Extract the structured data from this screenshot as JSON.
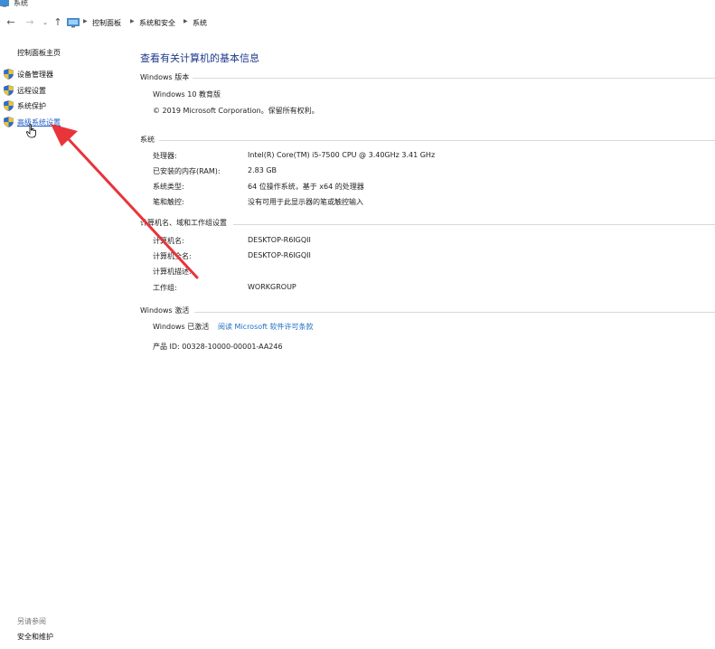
{
  "window": {
    "title": "系统"
  },
  "breadcrumb": {
    "items": [
      "控制面板",
      "系统和安全",
      "系统"
    ]
  },
  "sidebar": {
    "home_label": "控制面板主页",
    "items": [
      {
        "label": "设备管理器"
      },
      {
        "label": "远程设置"
      },
      {
        "label": "系统保护"
      },
      {
        "label": "高级系统设置"
      }
    ],
    "see_also_label": "另请参阅",
    "see_also_items": [
      {
        "label": "安全和维护"
      }
    ]
  },
  "main": {
    "title": "查看有关计算机的基本信息",
    "edition": {
      "header": "Windows 版本",
      "name": "Windows 10 教育版",
      "copyright": "© 2019 Microsoft Corporation。保留所有权利。"
    },
    "system": {
      "header": "系统",
      "rows": [
        {
          "label": "处理器:",
          "value": "Intel(R) Core(TM) i5-7500 CPU @ 3.40GHz   3.41 GHz"
        },
        {
          "label": "已安装的内存(RAM):",
          "value": "2.83 GB"
        },
        {
          "label": "系统类型:",
          "value": "64 位操作系统，基于 x64 的处理器"
        },
        {
          "label": "笔和触控:",
          "value": "没有可用于此显示器的笔或触控输入"
        }
      ]
    },
    "computer_name": {
      "header": "计算机名、域和工作组设置",
      "rows": [
        {
          "label": "计算机名:",
          "value": "DESKTOP-R6IGQII"
        },
        {
          "label": "计算机全名:",
          "value": "DESKTOP-R6IGQII"
        },
        {
          "label": "计算机描述:",
          "value": ""
        },
        {
          "label": "工作组:",
          "value": "WORKGROUP"
        }
      ]
    },
    "activation": {
      "header": "Windows 激活",
      "status": "Windows 已激活",
      "license_link": "阅读 Microsoft 软件许可条款",
      "product_id": "产品 ID: 00328-10000-00001-AA246"
    }
  },
  "colors": {
    "accent_link": "#1f6fc5",
    "title_blue": "#1e3a8a",
    "annotation_arrow": "#e8343a"
  }
}
